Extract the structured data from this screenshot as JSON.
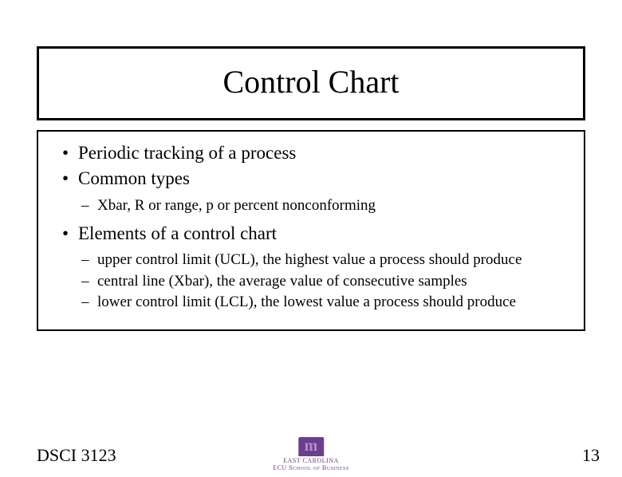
{
  "title": "Control Chart",
  "bullets": {
    "b1": "Periodic tracking of a process",
    "b2": "Common types",
    "b2_sub": {
      "s1": "Xbar, R or range, p or percent nonconforming"
    },
    "b3": "Elements of a control chart",
    "b3_sub": {
      "s1": "upper control limit (UCL), the highest value a process should produce",
      "s2": "central line (Xbar), the average value of consecutive samples",
      "s3": "lower control limit (LCL), the lowest value a process should produce"
    }
  },
  "footer": {
    "course": "DSCI 3123",
    "page": "13",
    "logo_line1": "EAST CAROLINA",
    "logo_line2": "ECU School of Business"
  }
}
